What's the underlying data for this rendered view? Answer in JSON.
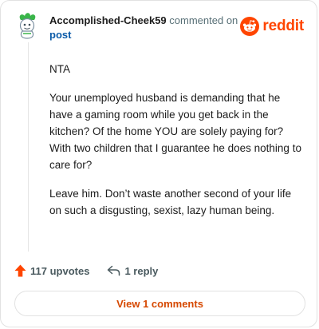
{
  "header": {
    "username": "Accomplished-Cheek59",
    "commented_text": "commented on",
    "post_link": "post"
  },
  "brand": {
    "wordmark": "reddit",
    "color": "#ff4500"
  },
  "comment": {
    "paragraphs": [
      "NTA",
      "Your unemployed husband is demanding that he have a gaming room while you get back in the kitchen? Of the home YOU are solely paying for? With two children that I guarantee he does nothing to care for?",
      "Leave him. Don’t waste another second of your life on such a disgusting, sexist, lazy human being."
    ]
  },
  "actions": {
    "upvotes": "117 upvotes",
    "replies": "1 reply"
  },
  "view_button": "View 1 comments",
  "icons": {
    "avatar": "avatar-icon",
    "reddit": "reddit-snoo-icon",
    "upvote": "upvote-arrow-icon",
    "reply": "reply-arrow-icon"
  },
  "colors": {
    "upvote": "#ff4500",
    "link": "#0a5aa8",
    "view_button_text": "#d64800"
  }
}
